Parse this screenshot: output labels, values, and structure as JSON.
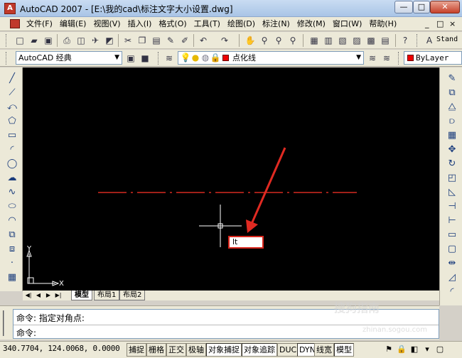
{
  "window": {
    "title": "AutoCAD 2007 - [E:\\我的cad\\标注文字大小设置.dwg]",
    "min_symbol": "—",
    "max_symbol": "□",
    "close_symbol": "✕"
  },
  "menu": {
    "items": [
      "文件(F)",
      "编辑(E)",
      "视图(V)",
      "插入(I)",
      "格式(O)",
      "工具(T)",
      "绘图(D)",
      "标注(N)",
      "修改(M)",
      "窗口(W)",
      "帮助(H)"
    ],
    "mdi_min": "_",
    "mdi_restore": "□",
    "mdi_close": "×"
  },
  "toolbar": {
    "text_style_label": "Stand",
    "workspace": "AutoCAD 经典",
    "layer_name": "点化线",
    "color": "ByLayer"
  },
  "canvas": {
    "command_input": "lt",
    "ucs_y": "Y",
    "ucs_x": "X"
  },
  "tabs": {
    "items": [
      "模型",
      "布局1",
      "布局2"
    ],
    "active_index": 0
  },
  "command": {
    "line1": "命令: 指定对角点:",
    "line2": "命令:"
  },
  "status": {
    "coords": "340.7704, 124.0068, 0.0000",
    "buttons": [
      "捕捉",
      "栅格",
      "正交",
      "极轴",
      "对象捕捉",
      "对象追踪",
      "DUCS",
      "DYN",
      "线宽",
      "模型"
    ],
    "active_buttons": [
      "对象捕捉",
      "对象追踪",
      "DYN",
      "模型"
    ]
  },
  "watermark": {
    "text": "搜狗指南",
    "url": "zhinan.sogou.com"
  },
  "colors": {
    "canvas_bg": "#000000",
    "line_color": "#d62a20",
    "arrow_color": "#e02a22",
    "crosshair": "#ffffff"
  }
}
